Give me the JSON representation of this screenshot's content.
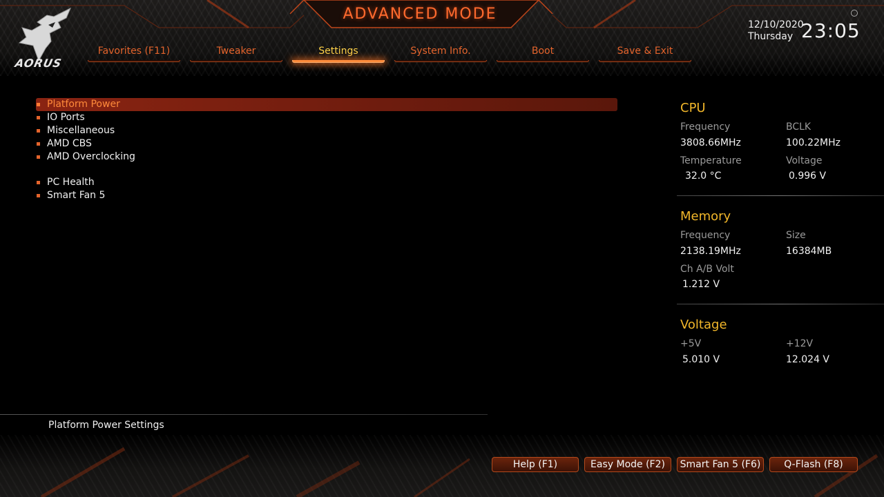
{
  "header": {
    "brand": "AORUS",
    "mode_title": "ADVANCED MODE",
    "date": "12/10/2020",
    "weekday": "Thursday",
    "time": "23:05",
    "icons": {
      "logo": "aorus-eagle-icon",
      "settings": "gear-icon"
    }
  },
  "tabs": [
    {
      "label": "Favorites (F11)",
      "active": false
    },
    {
      "label": "Tweaker",
      "active": false
    },
    {
      "label": "Settings",
      "active": true
    },
    {
      "label": "System Info.",
      "active": false
    },
    {
      "label": "Boot",
      "active": false
    },
    {
      "label": "Save & Exit",
      "active": false
    }
  ],
  "menu": {
    "items": [
      {
        "label": "Platform Power",
        "selected": true
      },
      {
        "label": "IO Ports",
        "selected": false
      },
      {
        "label": "Miscellaneous",
        "selected": false
      },
      {
        "label": "AMD CBS",
        "selected": false
      },
      {
        "label": "AMD Overclocking",
        "selected": false
      },
      {
        "label": "PC Health",
        "selected": false
      },
      {
        "label": "Smart Fan 5",
        "selected": false
      }
    ]
  },
  "status": {
    "cpu": {
      "title": "CPU",
      "frequency_label": "Frequency",
      "frequency_value": "3808.66MHz",
      "bclk_label": "BCLK",
      "bclk_value": "100.22MHz",
      "temperature_label": "Temperature",
      "temperature_value": "32.0 °C",
      "voltage_label": "Voltage",
      "voltage_value": "0.996 V"
    },
    "memory": {
      "title": "Memory",
      "frequency_label": "Frequency",
      "frequency_value": "2138.19MHz",
      "size_label": "Size",
      "size_value": "16384MB",
      "chvolt_label": "Ch A/B Volt",
      "chvolt_value": "1.212 V"
    },
    "voltage": {
      "title": "Voltage",
      "v5_label": "+5V",
      "v5_value": "5.010 V",
      "v12_label": "+12V",
      "v12_value": "12.024 V"
    }
  },
  "description": "Platform Power Settings",
  "footer": {
    "buttons": [
      "Help (F1)",
      "Easy Mode (F2)",
      "Smart Fan 5 (F6)",
      "Q-Flash (F8)"
    ]
  },
  "colors": {
    "accent": "#e4642c",
    "highlight": "#ffd24a",
    "section_title": "#f2b72a",
    "selected_row": "#8a2412"
  }
}
